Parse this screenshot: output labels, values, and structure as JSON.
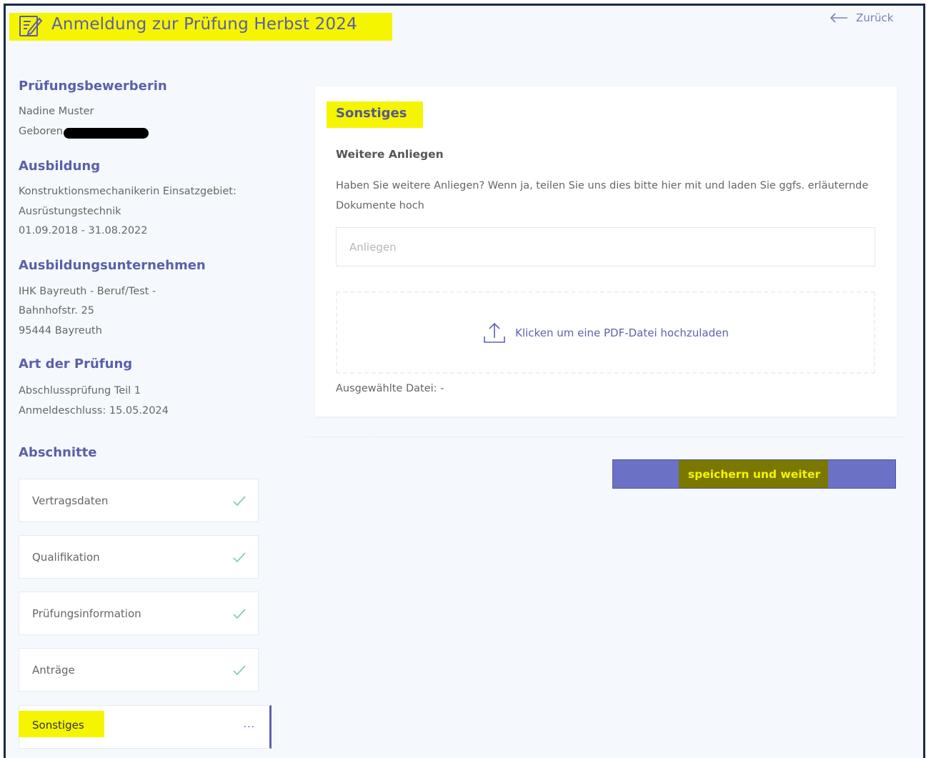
{
  "header": {
    "title": "Anmeldung zur Prüfung Herbst 2024",
    "title_icon": "edit-document-icon",
    "back_label": "Zurück",
    "back_icon": "arrow-left-icon"
  },
  "applicant": {
    "heading": "Prüfungsbewerberin",
    "name": "Nadine Muster",
    "born_label": "Geboren"
  },
  "training": {
    "heading": "Ausbildung",
    "line1": "Konstruktionsmechanikerin Einsatzgebiet:",
    "line2": "Ausrüstungstechnik",
    "period": "01.09.2018 - 31.08.2022"
  },
  "company": {
    "heading": "Ausbildungsunternehmen",
    "name": "IHK Bayreuth - Beruf/Test -",
    "street": "Bahnhofstr. 25",
    "city": "95444 Bayreuth"
  },
  "exam": {
    "heading": "Art der Prüfung",
    "type": "Abschlussprüfung Teil 1",
    "deadline": "Anmeldeschluss: 15.05.2024"
  },
  "sections": {
    "heading": "Abschnitte",
    "items": [
      {
        "label": "Vertragsdaten",
        "status": "done"
      },
      {
        "label": "Qualifikation",
        "status": "done"
      },
      {
        "label": "Prüfungsinformation",
        "status": "done"
      },
      {
        "label": "Anträge",
        "status": "done"
      },
      {
        "label": "Sonstiges",
        "status": "active",
        "indicator": "···"
      }
    ]
  },
  "main": {
    "card_title": "Sonstiges",
    "subheading": "Weitere Anliegen",
    "description": "Haben Sie weitere Anliegen? Wenn ja, teilen Sie uns dies bitte hier mit und laden Sie ggfs. erläuternde Dokumente hoch",
    "input_placeholder": "Anliegen",
    "upload_label": "Klicken um eine PDF-Datei hochzuladen",
    "upload_icon": "upload-icon",
    "selected_file": "Ausgewählte Datei: -",
    "save_label": "speichern und weiter"
  },
  "colors": {
    "accent": "#5d62b0",
    "highlight": "#f5f500",
    "check": "#7fd3a0",
    "background": "#f5f9fd"
  }
}
